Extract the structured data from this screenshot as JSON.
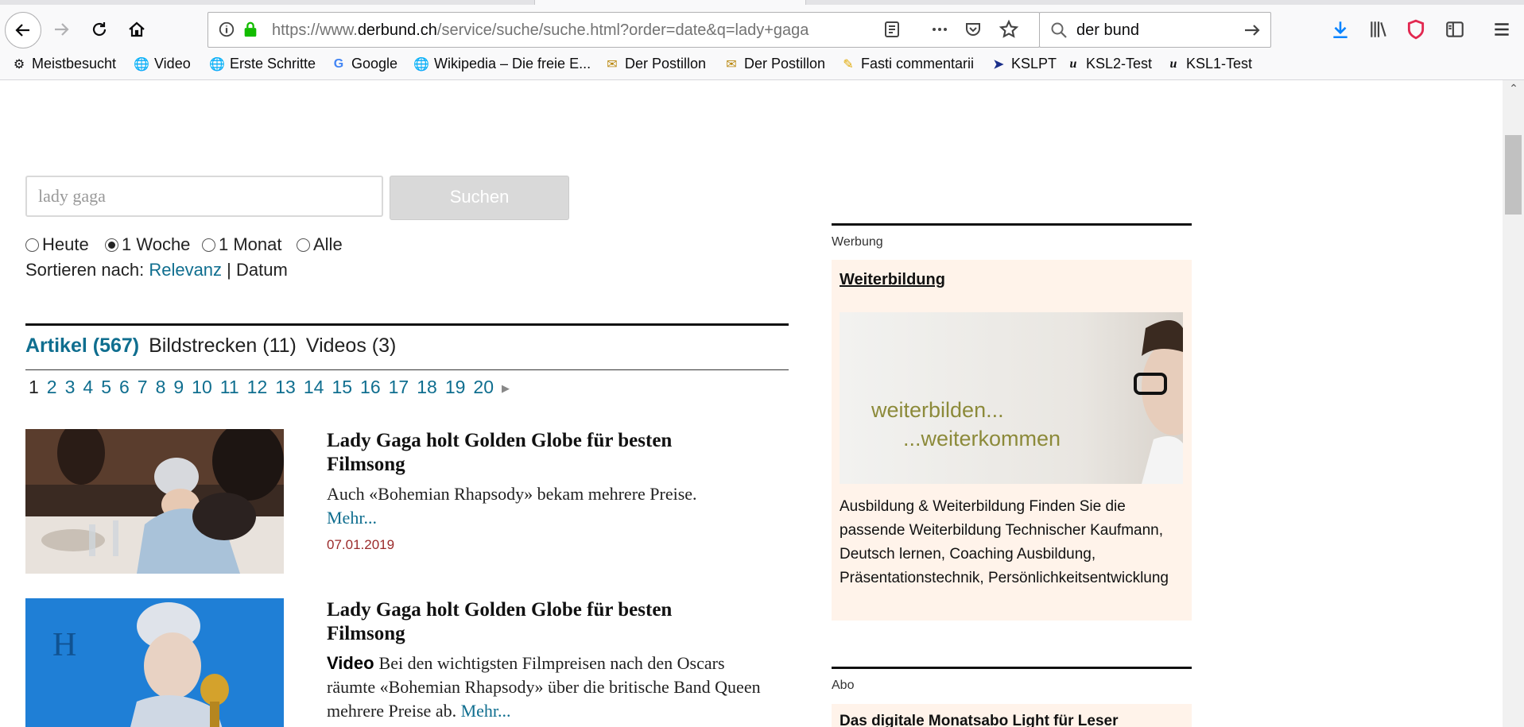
{
  "browser": {
    "url_prefix": "https://www.",
    "url_domain": "derbund.ch",
    "url_rest": "/service/suche/suche.html?order=date&q=lady+gaga",
    "search_value": "der bund",
    "bookmarks": [
      "Meistbesucht",
      "Video",
      "Erste Schritte",
      "Google",
      "Wikipedia – Die freie E...",
      "Der Postillon",
      "Der Postillon",
      "Fasti commentarii",
      "KSLPT",
      "KSL2-Test",
      "KSL1-Test"
    ]
  },
  "search": {
    "query": "lady gaga",
    "button_label": "Suchen"
  },
  "filters": {
    "time_options": [
      "Heute",
      "1 Woche",
      "1 Monat",
      "Alle"
    ],
    "selected": "1 Woche",
    "sort_label": "Sortieren nach:",
    "sort_relevance": "Relevanz",
    "sort_separator": "|",
    "sort_date": "Datum"
  },
  "tabs": {
    "articles": "Artikel (567)",
    "galleries": "Bildstrecken (11)",
    "videos": "Videos (3)"
  },
  "pagination": {
    "current": "1",
    "pages": [
      "2",
      "3",
      "4",
      "5",
      "6",
      "7",
      "8",
      "9",
      "10",
      "11",
      "12",
      "13",
      "14",
      "15",
      "16",
      "17",
      "18",
      "19",
      "20"
    ]
  },
  "results": [
    {
      "title": "Lady Gaga holt Golden Globe für besten Filmsong",
      "teaser": "Auch «Bohemian Rhapsody» bekam mehrere Preise.",
      "more": "Mehr...",
      "date": "07.01.2019"
    },
    {
      "title": "Lady Gaga holt Golden Globe für besten Filmsong",
      "badge": "Video",
      "teaser": "Bei den wichtigsten Filmpreisen nach den Oscars räumte «Bohemian Rhapsody» über die britische Band Queen mehrere Preise ab.",
      "more": "Mehr..."
    }
  ],
  "sidebar": {
    "ad_label": "Werbung",
    "ad_title": "Weiterbildung",
    "ad_image_line1": "weiterbilden...",
    "ad_image_line2": "...weiterkommen",
    "ad_text": "Ausbildung & Weiterbildung Finden Sie die passende Weiterbildung Technischer Kaufmann, Deutsch lernen, Coaching Ausbildung, Präsentationstechnik, Persönlichkeitsentwicklung",
    "abo_label": "Abo",
    "abo_title": "Das digitale Monatsabo Light für Leser"
  },
  "colors": {
    "link": "#0f6e8f",
    "date": "#9b2b2b",
    "ad_background": "#fff3ea"
  }
}
